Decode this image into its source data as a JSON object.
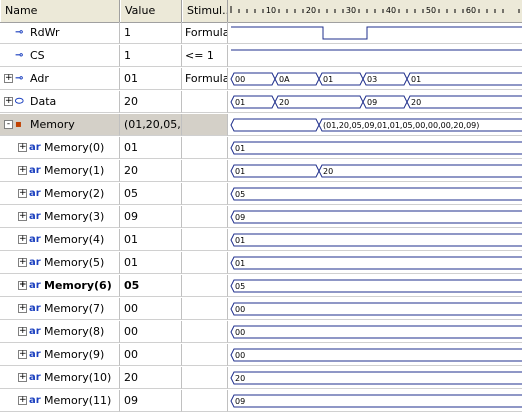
{
  "columns": {
    "name": "Name",
    "value": "Value",
    "stimulus": "Stimul..."
  },
  "ruler": {
    "ticks": [
      "10",
      "20",
      "30",
      "40",
      "50",
      "60"
    ]
  },
  "signals": [
    {
      "name": "RdWr",
      "value": "1",
      "stimulus": "Formula",
      "icon": "output-pin-icon",
      "expander": "",
      "indent": 0,
      "wave": {
        "kind": "bit",
        "edges": [
          0,
          23,
          34
        ],
        "levels": [
          1,
          0,
          1
        ]
      }
    },
    {
      "name": "CS",
      "value": "1",
      "stimulus": "<= 1",
      "icon": "output-pin-icon",
      "expander": "",
      "indent": 0,
      "wave": {
        "kind": "bit",
        "edges": [
          0
        ],
        "levels": [
          1
        ]
      }
    },
    {
      "name": "Adr",
      "value": "01",
      "stimulus": "Formula",
      "icon": "output-pin-icon",
      "expander": "+",
      "indent": 0,
      "wave": {
        "kind": "bus",
        "edges": [
          0,
          11,
          22,
          33,
          44
        ],
        "labels": [
          "00",
          "0A",
          "01",
          "03",
          "01"
        ]
      }
    },
    {
      "name": "Data",
      "value": "20",
      "stimulus": "",
      "icon": "bus-pin-icon",
      "expander": "+",
      "indent": 0,
      "wave": {
        "kind": "bus",
        "edges": [
          0,
          11,
          33,
          44
        ],
        "labels": [
          "01",
          "20",
          "09",
          "20"
        ]
      }
    },
    {
      "name": "Memory",
      "value": "(01,20,05,...",
      "stimulus": "",
      "icon": "memory-icon",
      "expander": "-",
      "indent": 0,
      "selected": true,
      "wave": {
        "kind": "bus",
        "edges": [
          0,
          22
        ],
        "labels": [
          "",
          "(01,20,05,09,01,01,05,00,00,00,20,09)"
        ]
      }
    },
    {
      "name": "Memory(0)",
      "value": "01",
      "stimulus": "",
      "icon": "array-icon",
      "expander": "+",
      "indent": 1,
      "wave": {
        "kind": "bus",
        "edges": [
          0
        ],
        "labels": [
          "01"
        ]
      }
    },
    {
      "name": "Memory(1)",
      "value": "20",
      "stimulus": "",
      "icon": "array-icon",
      "expander": "+",
      "indent": 1,
      "wave": {
        "kind": "bus",
        "edges": [
          0,
          22
        ],
        "labels": [
          "01",
          "20"
        ]
      }
    },
    {
      "name": "Memory(2)",
      "value": "05",
      "stimulus": "",
      "icon": "array-icon",
      "expander": "+",
      "indent": 1,
      "wave": {
        "kind": "bus",
        "edges": [
          0
        ],
        "labels": [
          "05"
        ]
      }
    },
    {
      "name": "Memory(3)",
      "value": "09",
      "stimulus": "",
      "icon": "array-icon",
      "expander": "+",
      "indent": 1,
      "wave": {
        "kind": "bus",
        "edges": [
          0
        ],
        "labels": [
          "09"
        ]
      }
    },
    {
      "name": "Memory(4)",
      "value": "01",
      "stimulus": "",
      "icon": "array-icon",
      "expander": "+",
      "indent": 1,
      "wave": {
        "kind": "bus",
        "edges": [
          0
        ],
        "labels": [
          "01"
        ]
      }
    },
    {
      "name": "Memory(5)",
      "value": "01",
      "stimulus": "",
      "icon": "array-icon",
      "expander": "+",
      "indent": 1,
      "wave": {
        "kind": "bus",
        "edges": [
          0
        ],
        "labels": [
          "01"
        ]
      }
    },
    {
      "name": "Memory(6)",
      "value": "05",
      "stimulus": "",
      "icon": "array-icon",
      "expander": "+",
      "indent": 1,
      "bold": true,
      "wave": {
        "kind": "bus",
        "edges": [
          0
        ],
        "labels": [
          "05"
        ]
      }
    },
    {
      "name": "Memory(7)",
      "value": "00",
      "stimulus": "",
      "icon": "array-icon",
      "expander": "+",
      "indent": 1,
      "wave": {
        "kind": "bus",
        "edges": [
          0
        ],
        "labels": [
          "00"
        ]
      }
    },
    {
      "name": "Memory(8)",
      "value": "00",
      "stimulus": "",
      "icon": "array-icon",
      "expander": "+",
      "indent": 1,
      "wave": {
        "kind": "bus",
        "edges": [
          0
        ],
        "labels": [
          "00"
        ]
      }
    },
    {
      "name": "Memory(9)",
      "value": "00",
      "stimulus": "",
      "icon": "array-icon",
      "expander": "+",
      "indent": 1,
      "wave": {
        "kind": "bus",
        "edges": [
          0
        ],
        "labels": [
          "00"
        ]
      }
    },
    {
      "name": "Memory(10)",
      "value": "20",
      "stimulus": "",
      "icon": "array-icon",
      "expander": "+",
      "indent": 1,
      "wave": {
        "kind": "bus",
        "edges": [
          0
        ],
        "labels": [
          "20"
        ]
      }
    },
    {
      "name": "Memory(11)",
      "value": "09",
      "stimulus": "",
      "icon": "array-icon",
      "expander": "+",
      "indent": 1,
      "wave": {
        "kind": "bus",
        "edges": [
          0
        ],
        "labels": [
          "09"
        ]
      }
    }
  ],
  "colors": {
    "wave": "#1f2f8c",
    "ruler_text": "#000000",
    "selected_row": "#d4d0c8"
  }
}
